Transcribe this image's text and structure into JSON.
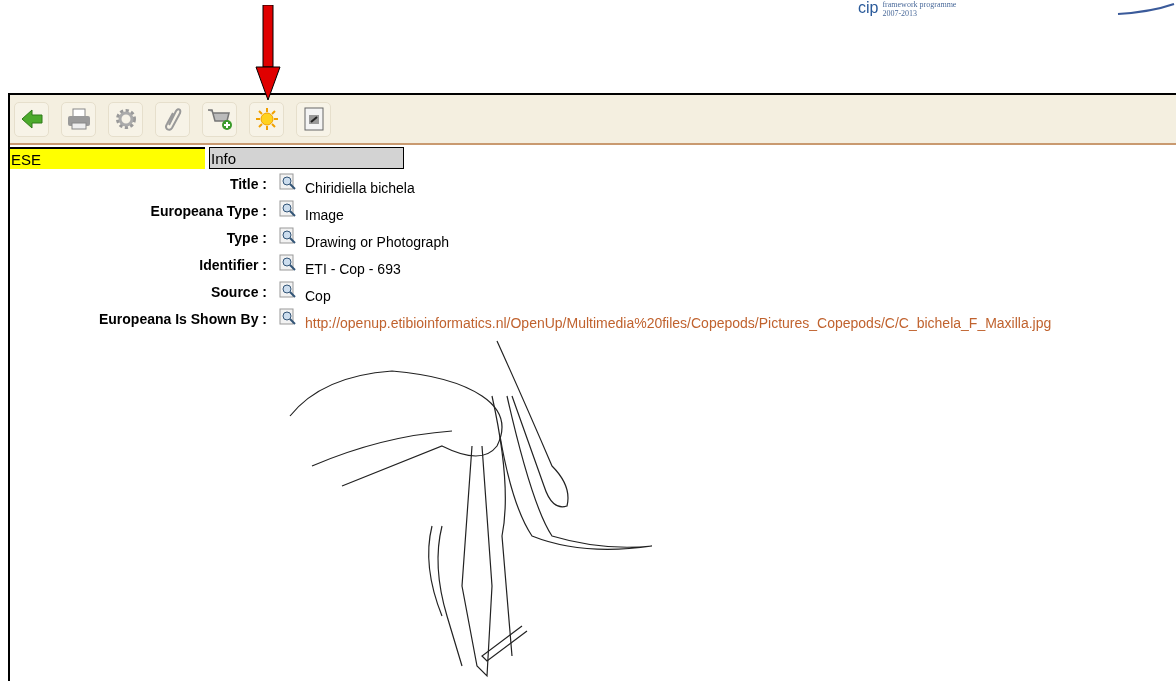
{
  "logo": {
    "mark": "cip",
    "line_1": "framework programme",
    "line_2": "2007-2013"
  },
  "tabs": [
    {
      "label": "ESE",
      "selected": true
    },
    {
      "label": "Info",
      "selected": false
    }
  ],
  "fields": [
    {
      "label": "Title :",
      "value": "Chiridiella bichela",
      "kind": "text"
    },
    {
      "label": "Europeana Type :",
      "value": "Image",
      "kind": "text"
    },
    {
      "label": "Type :",
      "value": "Drawing or Photograph",
      "kind": "text"
    },
    {
      "label": "Identifier :",
      "value": "ETI - Cop - 693",
      "kind": "text"
    },
    {
      "label": "Source :",
      "value": "Cop",
      "kind": "text"
    },
    {
      "label": "Europeana Is Shown By :",
      "value": "http://openup.etibioinformatics.nl/OpenUp/Multimedia%20files/Copepods/Pictures_Copepods/C/C_bichela_F_Maxilla.jpg",
      "kind": "link"
    }
  ]
}
